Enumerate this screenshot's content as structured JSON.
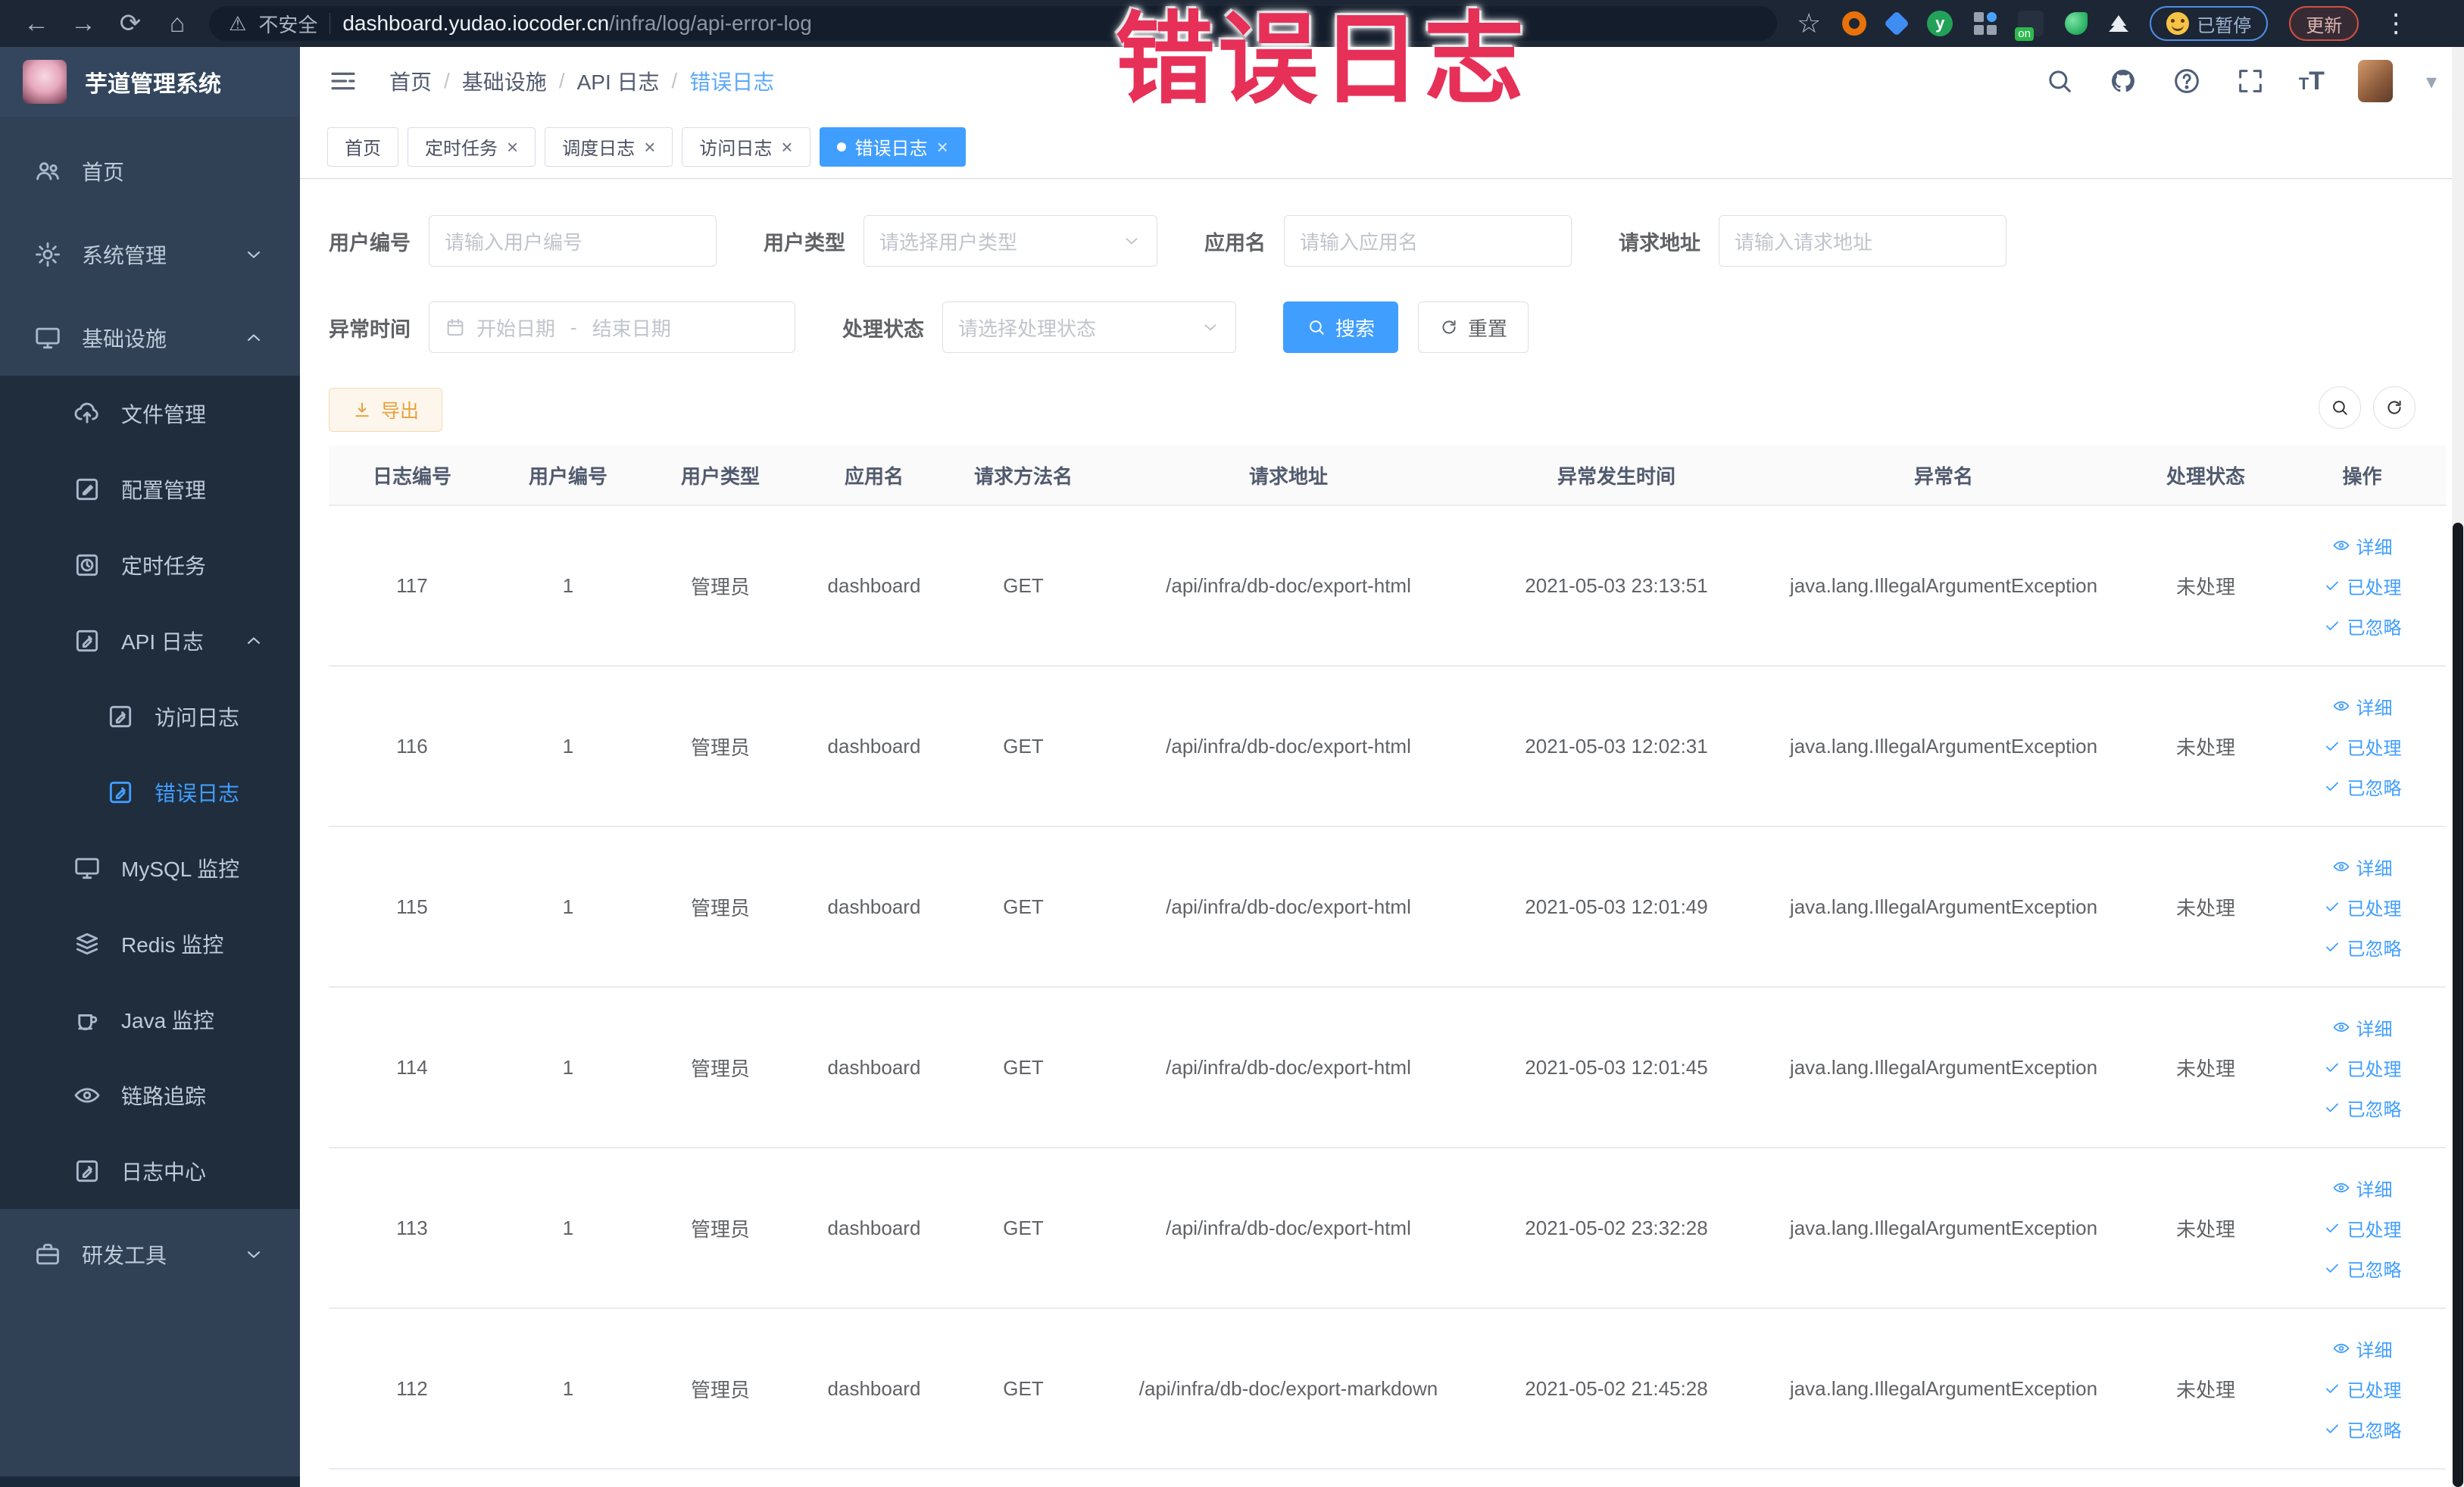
{
  "browser": {
    "security_label": "不安全",
    "url_domain": "dashboard.yudao.iocoder.cn",
    "url_path": "/infra/log/api-error-log",
    "paused_label": "已暂停",
    "update_label": "更新",
    "adblock_badge": "on"
  },
  "annotation": "错误日志",
  "sidebar": {
    "logo_title": "芋道管理系统",
    "items": [
      {
        "label": "首页",
        "icon": "people-icon",
        "level": 1
      },
      {
        "label": "系统管理",
        "icon": "gear-icon",
        "level": 1,
        "arrow": "chevron-down-icon"
      },
      {
        "label": "基础设施",
        "icon": "monitor-icon",
        "level": 1,
        "arrow": "chevron-up-icon"
      },
      {
        "label": "文件管理",
        "icon": "upload-icon",
        "level": 2
      },
      {
        "label": "配置管理",
        "icon": "edit-icon",
        "level": 2
      },
      {
        "label": "定时任务",
        "icon": "job-icon",
        "level": 2
      },
      {
        "label": "API 日志",
        "icon": "log-icon",
        "level": 2,
        "arrow": "chevron-up-icon"
      },
      {
        "label": "访问日志",
        "icon": "log-icon",
        "level": 3
      },
      {
        "label": "错误日志",
        "icon": "log-icon",
        "level": 3,
        "active": true
      },
      {
        "label": "MySQL 监控",
        "icon": "monitor-icon",
        "level": 2
      },
      {
        "label": "Redis 监控",
        "icon": "redis-icon",
        "level": 2
      },
      {
        "label": "Java 监控",
        "icon": "java-icon",
        "level": 2
      },
      {
        "label": "链路追踪",
        "icon": "eye-icon",
        "level": 2
      },
      {
        "label": "日志中心",
        "icon": "log-icon",
        "level": 2
      },
      {
        "label": "研发工具",
        "icon": "tool-icon",
        "level": 1,
        "arrow": "chevron-down-icon",
        "section": "bottom"
      }
    ]
  },
  "header": {
    "breadcrumbs": [
      {
        "label": "首页",
        "sep": "/"
      },
      {
        "label": "基础设施",
        "sep": "/"
      },
      {
        "label": "API 日志",
        "sep": "/"
      },
      {
        "label": "错误日志",
        "active": true
      }
    ]
  },
  "tabs": [
    {
      "label": "首页"
    },
    {
      "label": "定时任务",
      "closable": true
    },
    {
      "label": "调度日志",
      "closable": true
    },
    {
      "label": "访问日志",
      "closable": true
    },
    {
      "label": "错误日志",
      "closable": true,
      "active": true
    }
  ],
  "filters": {
    "user_id": {
      "label": "用户编号",
      "placeholder": "请输入用户编号"
    },
    "user_type": {
      "label": "用户类型",
      "placeholder": "请选择用户类型"
    },
    "app_name": {
      "label": "应用名",
      "placeholder": "请输入应用名"
    },
    "request_url": {
      "label": "请求地址",
      "placeholder": "请输入请求地址"
    },
    "exception_time": {
      "label": "异常时间",
      "start_placeholder": "开始日期",
      "separator": "-",
      "end_placeholder": "结束日期"
    },
    "process_status": {
      "label": "处理状态",
      "placeholder": "请选择处理状态"
    },
    "search_label": "搜索",
    "reset_label": "重置"
  },
  "toolbar": {
    "export_label": "导出"
  },
  "table": {
    "columns": [
      "日志编号",
      "用户编号",
      "用户类型",
      "应用名",
      "请求方法名",
      "请求地址",
      "异常发生时间",
      "异常名",
      "处理状态",
      "操作"
    ],
    "actions": [
      {
        "label": "详细"
      },
      {
        "label": "已处理"
      },
      {
        "label": "已忽略"
      }
    ],
    "rows": [
      {
        "id": "117",
        "user_id": "1",
        "user_type": "管理员",
        "app": "dashboard",
        "method": "GET",
        "url": "/api/infra/db-doc/export-html",
        "time": "2021-05-03 23:13:51",
        "exception": "java.lang.IllegalArgumentException",
        "status": "未处理"
      },
      {
        "id": "116",
        "user_id": "1",
        "user_type": "管理员",
        "app": "dashboard",
        "method": "GET",
        "url": "/api/infra/db-doc/export-html",
        "time": "2021-05-03 12:02:31",
        "exception": "java.lang.IllegalArgumentException",
        "status": "未处理"
      },
      {
        "id": "115",
        "user_id": "1",
        "user_type": "管理员",
        "app": "dashboard",
        "method": "GET",
        "url": "/api/infra/db-doc/export-html",
        "time": "2021-05-03 12:01:49",
        "exception": "java.lang.IllegalArgumentException",
        "status": "未处理"
      },
      {
        "id": "114",
        "user_id": "1",
        "user_type": "管理员",
        "app": "dashboard",
        "method": "GET",
        "url": "/api/infra/db-doc/export-html",
        "time": "2021-05-03 12:01:45",
        "exception": "java.lang.IllegalArgumentException",
        "status": "未处理"
      },
      {
        "id": "113",
        "user_id": "1",
        "user_type": "管理员",
        "app": "dashboard",
        "method": "GET",
        "url": "/api/infra/db-doc/export-html",
        "time": "2021-05-02 23:32:28",
        "exception": "java.lang.IllegalArgumentException",
        "status": "未处理"
      },
      {
        "id": "112",
        "user_id": "1",
        "user_type": "管理员",
        "app": "dashboard",
        "method": "GET",
        "url": "/api/infra/db-doc/export-markdown",
        "time": "2021-05-02 21:45:28",
        "exception": "java.lang.IllegalArgumentException",
        "status": "未处理"
      }
    ]
  },
  "colors": {
    "accent": "#409eff",
    "warning": "#e6a23c",
    "annotation": "#e73058",
    "sidebar": "#304156",
    "submenu": "#1f2d3d"
  }
}
